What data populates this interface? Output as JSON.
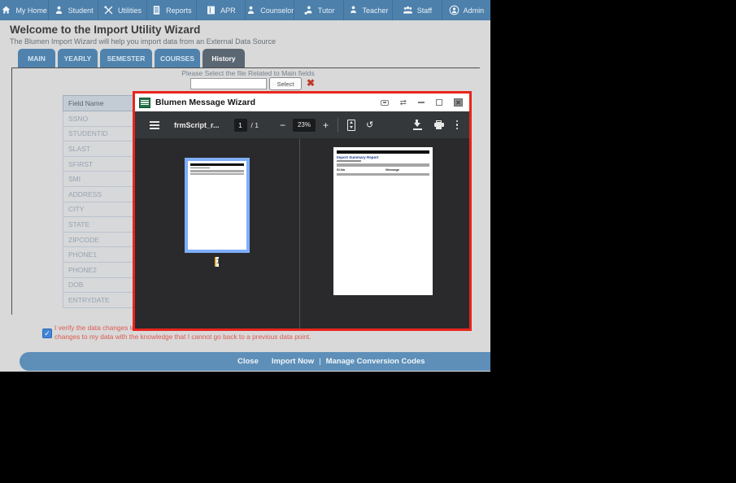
{
  "nav": {
    "items": [
      {
        "label": "My Home",
        "icon": "home-icon"
      },
      {
        "label": "Student",
        "icon": "student-icon"
      },
      {
        "label": "Utilities",
        "icon": "utilities-icon"
      },
      {
        "label": "Reports",
        "icon": "reports-icon"
      },
      {
        "label": "APR",
        "icon": "apr-icon"
      },
      {
        "label": "Counselor",
        "icon": "counselor-icon"
      },
      {
        "label": "Tutor",
        "icon": "tutor-icon"
      },
      {
        "label": "Teacher",
        "icon": "teacher-icon"
      },
      {
        "label": "Staff",
        "icon": "staff-icon"
      },
      {
        "label": "Admin",
        "icon": "admin-icon"
      }
    ]
  },
  "header": {
    "title": "Welcome to the Import Utility Wizard",
    "subtitle": "The Blumen Import Wizard will help you import data from an External Data Source"
  },
  "tabs": [
    {
      "label": "MAIN",
      "active": false
    },
    {
      "label": "YEARLY",
      "active": false
    },
    {
      "label": "SEMESTER",
      "active": false
    },
    {
      "label": "COURSES",
      "active": false
    },
    {
      "label": "History",
      "active": true
    }
  ],
  "file_select": {
    "instruction": "Please Select the file Related to Main fields",
    "input_value": "",
    "select_label": "Select",
    "remove_icon": "✖"
  },
  "field_table": {
    "header": "Field Name",
    "rows": [
      "SSNO",
      "STUDENTID",
      "SLAST",
      "SFIRST",
      "SMI",
      "ADDRESS",
      "CITY",
      "STATE",
      "ZIPCODE",
      "PHONE1",
      "PHONE2",
      "DOB",
      "ENTRYDATE"
    ]
  },
  "modal": {
    "title": "Blumen Message Wizard",
    "pdf": {
      "filename": "frmScript_r...",
      "page_current": "1",
      "page_total": "/ 1",
      "zoom_out": "−",
      "zoom_level": "23%",
      "zoom_in": "+",
      "rotate_glyph": "↺",
      "thumbnail_page_number": "1",
      "document": {
        "title": "Import Summary Report",
        "col1": "Sl.No",
        "col2": "Message"
      }
    }
  },
  "verify": {
    "checked": true,
    "check_glyph": "✓",
    "line1": "I verify the data changes to",
    "line2": "changes to my data with the knowledge that I cannot go back to a previous data point."
  },
  "bottom_bar": {
    "close": "Close",
    "import_now": "Import Now",
    "separator": "|",
    "manage": "Manage Conversion Codes"
  },
  "colors": {
    "nav_blue": "#4d80ab",
    "tab_blue": "#4f83ad",
    "tab_active": "#5b6673",
    "modal_border_red": "#e8251d",
    "selection_blue": "#7faef8",
    "checkbox_blue": "#4285d6",
    "bottom_bar_blue": "#5d8fb8",
    "verify_text_red": "#dd5a50"
  }
}
